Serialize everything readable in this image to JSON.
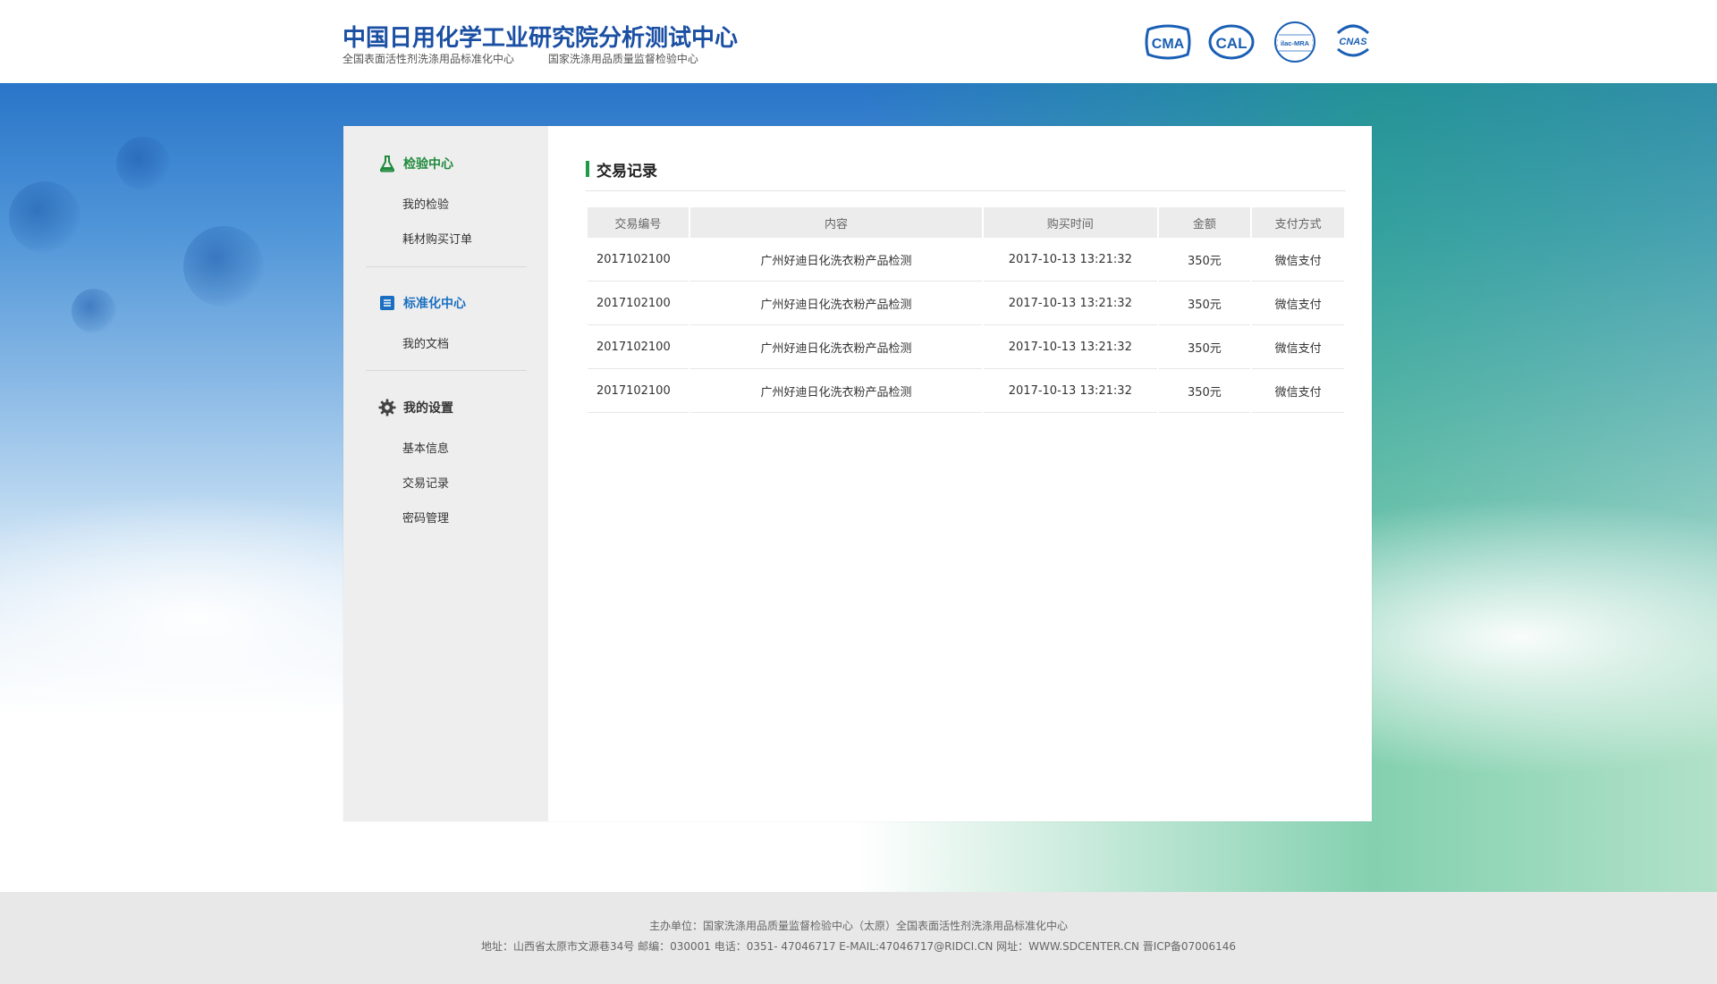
{
  "header": {
    "title": "中国日用化学工业研究院分析测试中心",
    "subtitle_left": "全国表面活性剂洗涤用品标准化中心",
    "subtitle_right": "国家洗涤用品质量监督检验中心",
    "certs": [
      {
        "name": "cma-logo",
        "text": "CMA"
      },
      {
        "name": "cal-logo",
        "text": "CAL"
      },
      {
        "name": "ilac-mra-logo",
        "text": "ilac-MRA"
      },
      {
        "name": "cnas-logo",
        "text": "CNAS"
      }
    ]
  },
  "sidebar": {
    "groups": [
      {
        "title": "检验中心",
        "icon": "flask-icon",
        "color": "#1e8a3c",
        "items": [
          "我的检验",
          "耗材购买订单"
        ]
      },
      {
        "title": "标准化中心",
        "icon": "document-icon",
        "color": "#1a6fc0",
        "items": [
          "我的文档"
        ]
      },
      {
        "title": "我的设置",
        "icon": "gear-icon",
        "color": "#333333",
        "items": [
          "基本信息",
          "交易记录",
          "密码管理"
        ]
      }
    ]
  },
  "content": {
    "title": "交易记录",
    "accent": "#1e9a4a",
    "table": {
      "headers": [
        "交易编号",
        "内容",
        "购买时间",
        "金额",
        "支付方式"
      ],
      "rows": [
        [
          "2017102100",
          "广州好迪日化洗衣粉产品检测",
          "2017-10-13  13:21:32",
          "350元",
          "微信支付"
        ],
        [
          "2017102100",
          "广州好迪日化洗衣粉产品检测",
          "2017-10-13  13:21:32",
          "350元",
          "微信支付"
        ],
        [
          "2017102100",
          "广州好迪日化洗衣粉产品检测",
          "2017-10-13  13:21:32",
          "350元",
          "微信支付"
        ],
        [
          "2017102100",
          "广州好迪日化洗衣粉产品检测",
          "2017-10-13  13:21:32",
          "350元",
          "微信支付"
        ]
      ]
    }
  },
  "footer": {
    "line1": "主办单位：国家洗涤用品质量监督检验中心（太原）全国表面活性剂洗涤用品标准化中心",
    "line2": "地址：山西省太原市文源巷34号   邮编：030001   电话：0351- 47046717     E-MAIL:47046717@RIDCI.CN    网址：WWW.SDCENTER.CN    晋ICP备07006146"
  }
}
